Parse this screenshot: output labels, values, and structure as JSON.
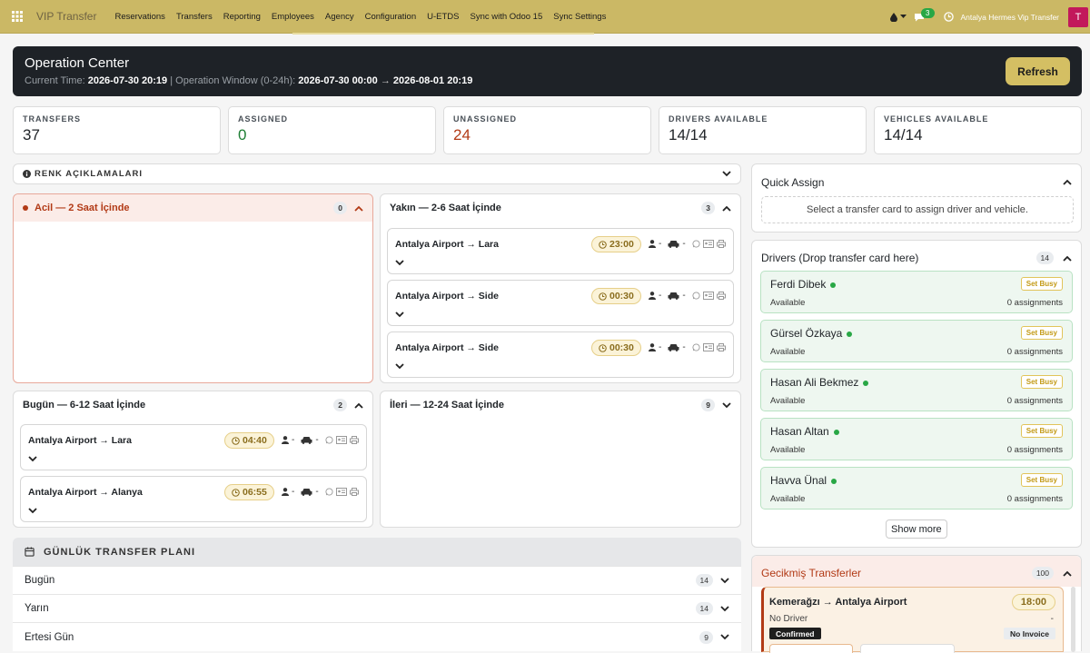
{
  "topbar": {
    "brand": "VIP Transfer",
    "menu": [
      "Reservations",
      "Transfers",
      "Reporting",
      "Employees",
      "Agency",
      "Configuration",
      "U-ETDS",
      "Sync with Odoo 15",
      "Sync Settings"
    ],
    "message_count": "3",
    "company": "Antalya Hermes Vip Transfer",
    "avatar_letter": "T"
  },
  "hero": {
    "title": "Operation Center",
    "current_time_label": "Current Time:",
    "current_time": "2026-07-30 20:19",
    "window_label": "| Operation Window (0-24h):",
    "window_start": "2026-07-30 00:00",
    "arrow": "→",
    "window_end": "2026-08-01 20:19",
    "refresh_label": "Refresh"
  },
  "stats": [
    {
      "label": "TRANSFERS",
      "value": "37",
      "color": "#212529"
    },
    {
      "label": "ASSIGNED",
      "value": "0",
      "color": "#1e7e34"
    },
    {
      "label": "UNASSIGNED",
      "value": "24",
      "color": "#b23a16"
    },
    {
      "label": "DRIVERS AVAILABLE",
      "value": "14/14",
      "color": "#212529"
    },
    {
      "label": "VEHICLES AVAILABLE",
      "value": "14/14",
      "color": "#212529"
    }
  ],
  "legend": {
    "title": "RENK AÇIKLAMALARI"
  },
  "buckets": {
    "acil": {
      "title": "Acil — 2 Saat İçinde",
      "count": "0"
    },
    "yakin": {
      "title": "Yakın — 2-6 Saat İçinde",
      "count": "3"
    },
    "bugun": {
      "title": "Bugün — 6-12 Saat İçinde",
      "count": "2"
    },
    "ileri": {
      "title": "İleri — 12-24 Saat İçinde",
      "count": "9"
    }
  },
  "transfers": {
    "yakin": [
      {
        "route": "Antalya Airport → Lara",
        "time": "23:00"
      },
      {
        "route": "Antalya Airport → Side",
        "time": "00:30"
      },
      {
        "route": "Antalya Airport → Side",
        "time": "00:30"
      }
    ],
    "bugun": [
      {
        "route": "Antalya Airport → Lara",
        "time": "04:40"
      },
      {
        "route": "Antalya Airport → Alanya",
        "time": "06:55"
      }
    ],
    "dash": "-"
  },
  "plan": {
    "title": "GÜNLÜK TRANSFER PLANI",
    "rows": [
      {
        "label": "Bugün",
        "count": "14"
      },
      {
        "label": "Yarın",
        "count": "14"
      },
      {
        "label": "Ertesi Gün",
        "count": "9"
      }
    ]
  },
  "quick_assign": {
    "title": "Quick Assign",
    "hint": "Select a transfer card to assign driver and vehicle."
  },
  "drivers": {
    "title": "Drivers (Drop transfer card here)",
    "count": "14",
    "set_busy": "Set Busy",
    "list": [
      {
        "name": "Ferdi Dibek",
        "status": "Available",
        "assignments": "0 assignments"
      },
      {
        "name": "Gürsel Özkaya",
        "status": "Available",
        "assignments": "0 assignments"
      },
      {
        "name": "Hasan Ali Bekmez",
        "status": "Available",
        "assignments": "0 assignments"
      },
      {
        "name": "Hasan Altan",
        "status": "Available",
        "assignments": "0 assignments"
      },
      {
        "name": "Havva Ünal",
        "status": "Available",
        "assignments": "0 assignments"
      }
    ],
    "show_more": "Show more"
  },
  "late": {
    "title": "Gecikmiş Transferler",
    "count": "100",
    "item": {
      "route": "Kemerağzı → Antalya Airport",
      "time": "18:00",
      "driver": "No Driver",
      "dash": "-",
      "status": "Confirmed",
      "invoice": "No Invoice"
    }
  },
  "colors": {
    "accent": "#cbb865",
    "urgent": "#b23a16",
    "success": "#28a745"
  }
}
